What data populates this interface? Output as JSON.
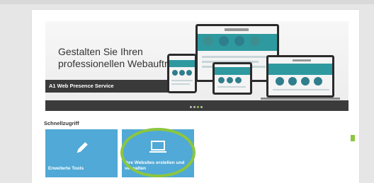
{
  "hero": {
    "headline": "Gestalten Sie Ihren professionellen Webauftritt.",
    "service_name": "A1 Web Presence Service",
    "slide_count": 4,
    "active_slide": 3
  },
  "quick_access": {
    "title": "Schnellzugriff",
    "tiles": [
      {
        "label": "Erweiterte Tools",
        "icon": "pencil-icon"
      },
      {
        "label": "Ihre Websites erstellen und verwalten",
        "icon": "laptop-icon"
      }
    ]
  },
  "colors": {
    "tile_blue": "#50a9d6",
    "highlight_green": "#8cc63f",
    "teal": "#2e9aa0"
  }
}
